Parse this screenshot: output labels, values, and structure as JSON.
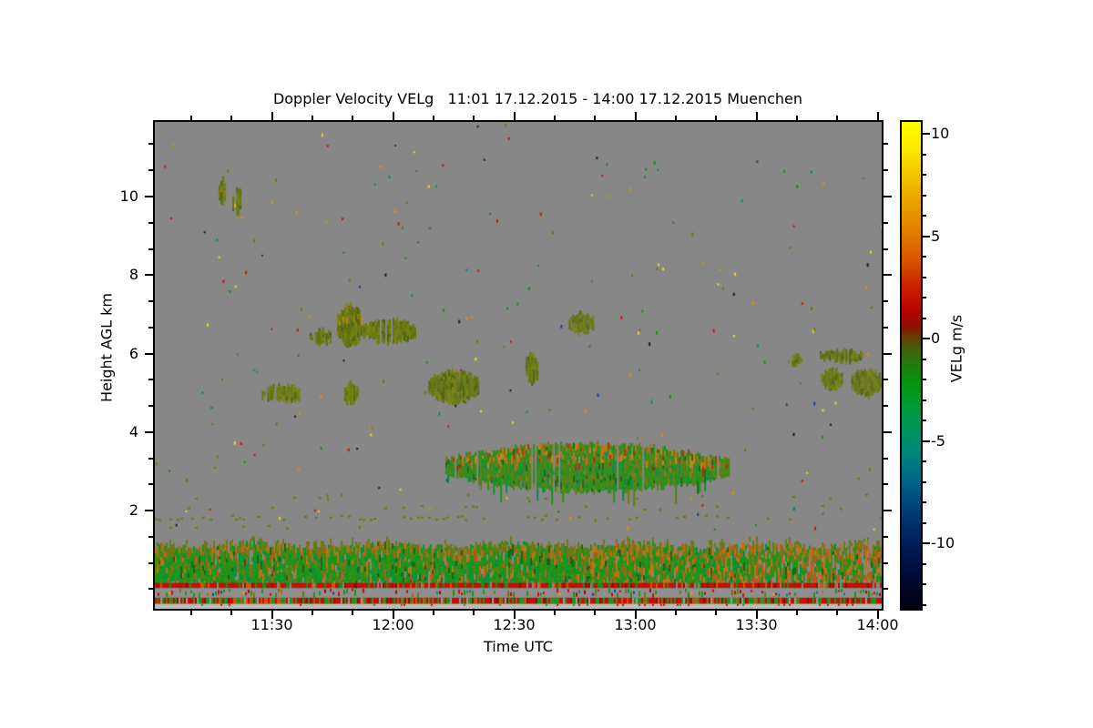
{
  "chart_data": {
    "type": "heatmap",
    "title": "Doppler Velocity VELg   11:01 17.12.2015 - 14:00 17.12.2015 Muenchen",
    "xlabel": "Time UTC",
    "ylabel": "Height AGL km",
    "x_range_minutes": [
      661,
      841
    ],
    "x_ticks": [
      {
        "label": "11:30",
        "min": 690
      },
      {
        "label": "12:00",
        "min": 720
      },
      {
        "label": "12:30",
        "min": 750
      },
      {
        "label": "13:00",
        "min": 780
      },
      {
        "label": "13:30",
        "min": 810
      },
      {
        "label": "14:00",
        "min": 840
      }
    ],
    "x_minor_step_min": 10,
    "y_range_km": [
      -0.5,
      11.9
    ],
    "y_ticks": [
      {
        "label": "10",
        "km": 10
      },
      {
        "label": "8",
        "km": 8
      },
      {
        "label": "6",
        "km": 6
      },
      {
        "label": "4",
        "km": 4
      },
      {
        "label": "2",
        "km": 2
      }
    ],
    "y_minor_step_km": 0.66667,
    "background_color": "#878787",
    "frame_color": "#000000",
    "grid": false,
    "seed": 20151217,
    "colorbar": {
      "label": "VELg m/s",
      "range": [
        -13.2,
        10.6
      ],
      "ticks": [
        {
          "label": "10",
          "v": 10
        },
        {
          "label": "5",
          "v": 5
        },
        {
          "label": "0",
          "v": 0
        },
        {
          "label": "-5",
          "v": -5
        },
        {
          "label": "-10",
          "v": -10
        }
      ],
      "minor_step": 1,
      "stops": [
        [
          10.6,
          "#ffff00"
        ],
        [
          9.2,
          "#fce800"
        ],
        [
          8.0,
          "#f2c400"
        ],
        [
          6.5,
          "#e89e00"
        ],
        [
          5.0,
          "#e07800"
        ],
        [
          3.8,
          "#d85200"
        ],
        [
          2.8,
          "#cc2a00"
        ],
        [
          2.0,
          "#c41000"
        ],
        [
          1.2,
          "#ae0300"
        ],
        [
          0.6,
          "#8c0f00"
        ],
        [
          0.1,
          "#683c00"
        ],
        [
          -0.5,
          "#44600a"
        ],
        [
          -1.3,
          "#1e7e0a"
        ],
        [
          -2.3,
          "#049410"
        ],
        [
          -3.3,
          "#009b38"
        ],
        [
          -4.5,
          "#00935f"
        ],
        [
          -5.5,
          "#008878"
        ],
        [
          -6.8,
          "#00688a"
        ],
        [
          -8.0,
          "#00487c"
        ],
        [
          -9.2,
          "#002c68"
        ],
        [
          -10.4,
          "#001850"
        ],
        [
          -11.8,
          "#000830"
        ],
        [
          -13.2,
          "#000010"
        ]
      ]
    },
    "features": {
      "speckles": {
        "count": 240,
        "min_height_km": 1.3,
        "palette": [
          [
            "#f2d219",
            2
          ],
          [
            "#e09000",
            1.5
          ],
          [
            "#c41a00",
            2
          ],
          [
            "#1e8c14",
            2
          ],
          [
            "#6b7a10",
            3
          ],
          [
            "#00897b",
            1
          ],
          [
            "#16418c",
            1
          ],
          [
            "#101c3c",
            1
          ]
        ]
      },
      "dotted_rows": [
        {
          "km": 1.84,
          "density": 0.16,
          "density_left": 0.34,
          "left_until_min": 745,
          "color": "#6b7a10"
        },
        {
          "km": 2.1,
          "density": 0.05,
          "density_left": 0.09,
          "left_until_min": 745,
          "color": "#6b7a10"
        },
        {
          "km": 2.37,
          "density": 0.04,
          "density_left": 0.07,
          "left_until_min": 760,
          "color": "#6b7a10"
        },
        {
          "km": 1.62,
          "density": 0.03,
          "density_left": 0.05,
          "left_until_min": 720,
          "color": "#6b7a10"
        }
      ],
      "clouds": [
        {
          "t": [
            676.8,
            678.4
          ],
          "h": [
            9.85,
            10.45
          ],
          "palette": "olive",
          "top_accent": true
        },
        {
          "t": [
            680.2,
            682.4
          ],
          "h": [
            9.55,
            10.23
          ],
          "palette": "olive"
        },
        {
          "t": [
            687.5,
            697.2
          ],
          "h": [
            4.8,
            5.2
          ],
          "palette": "olive"
        },
        {
          "t": [
            699.3,
            704.3
          ],
          "h": [
            6.28,
            6.62
          ],
          "palette": "olive"
        },
        {
          "t": [
            706.1,
            712.2
          ],
          "h": [
            6.2,
            7.25
          ],
          "palette": "olive",
          "top_accent": true
        },
        {
          "t": [
            712.2,
            725.3
          ],
          "h": [
            6.3,
            6.9
          ],
          "palette": "olive"
        },
        {
          "t": [
            707.9,
            711.2
          ],
          "h": [
            4.7,
            5.27
          ],
          "palette": "olive"
        },
        {
          "t": [
            728.7,
            741.1
          ],
          "h": [
            4.76,
            5.58
          ],
          "palette": "olive"
        },
        {
          "t": [
            752.4,
            755.9
          ],
          "h": [
            5.28,
            5.98
          ],
          "palette": "olive"
        },
        {
          "t": [
            763.5,
            769.4
          ],
          "h": [
            6.55,
            7.05
          ],
          "palette": "olive"
        },
        {
          "t": [
            817.8,
            821.2
          ],
          "h": [
            5.72,
            5.95
          ],
          "palette": "olive"
        },
        {
          "t": [
            825.7,
            836.4
          ],
          "h": [
            5.82,
            6.08
          ],
          "palette": "olive"
        },
        {
          "t": [
            826.0,
            831.0
          ],
          "h": [
            5.1,
            5.6
          ],
          "palette": "olive"
        },
        {
          "t": [
            833.5,
            841.0
          ],
          "h": [
            4.95,
            5.6
          ],
          "palette": "olive"
        },
        {
          "t": [
            733,
            803
          ],
          "palette": "green_mass",
          "top_accent": true,
          "spikes": 0.13,
          "envelope": true,
          "center_km": 3.12,
          "half_min": 0.18,
          "half_max": 0.6
        }
      ],
      "boundary_layer": {
        "top_km": 1.12,
        "green_bottom_km": 0.2,
        "red_stripe": [
          0.16,
          0.03
        ],
        "mixed_row": [
          0.02,
          -0.2
        ],
        "red_green_row": [
          -0.22,
          -0.37
        ],
        "pale_strip": [
          -0.38,
          -0.5
        ],
        "pale_color": "#bcbcbc"
      }
    }
  }
}
